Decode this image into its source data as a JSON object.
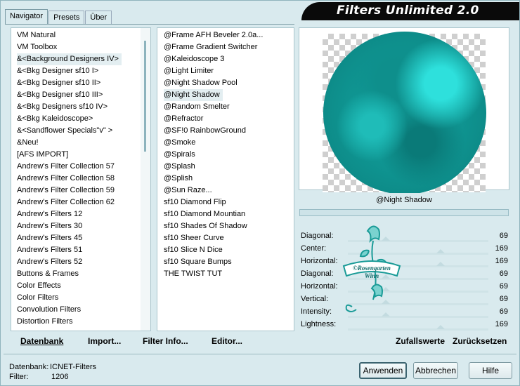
{
  "app": {
    "title": "Filters Unlimited 2.0"
  },
  "tabs": [
    {
      "label": "Navigator",
      "active": true
    },
    {
      "label": "Presets",
      "active": false
    },
    {
      "label": "Über",
      "active": false
    }
  ],
  "categories": [
    "VM Natural",
    "VM Toolbox",
    "&<Background Designers IV>",
    "&<Bkg Designer sf10 I>",
    "&<Bkg Designer sf10 II>",
    "&<Bkg Designer sf10 III>",
    "&<Bkg Designers sf10 IV>",
    "&<Bkg Kaleidoscope>",
    "&<Sandflower Specials\"v\" >",
    "&Neu!",
    "[AFS IMPORT]",
    "Andrew's Filter Collection 57",
    "Andrew's Filter Collection 58",
    "Andrew's Filter Collection 59",
    "Andrew's Filter Collection 62",
    "Andrew's Filters 12",
    "Andrew's Filters 30",
    "Andrew's Filters 45",
    "Andrew's Filters 51",
    "Andrew's Filters 52",
    "Buttons & Frames",
    "Color Effects",
    "Color Filters",
    "Convolution Filters",
    "Distortion Filters"
  ],
  "selected_category_index": 2,
  "filters": [
    "@Frame AFH Beveler 2.0a...",
    "@Frame Gradient Switcher",
    "@Kaleidoscope 3",
    "@Light Limiter",
    "@Night Shadow Pool",
    "@Night Shadow",
    "@Random Smelter",
    "@Refractor",
    "@SF!0 RainbowGround",
    "@Smoke",
    "@Spirals",
    "@Splash",
    "@Splish",
    "@Sun Raze...",
    "sf10 Diamond Flip",
    "sf10 Diamond Mountian",
    "sf10 Shades Of Shadow",
    "sf10 Sheer Curve",
    "sf10 Slice N Dice",
    "sf10 Square Bumps",
    "THE TWIST TUT"
  ],
  "selected_filter_index": 5,
  "preview": {
    "filter_name": "@Night Shadow",
    "color": "#14a8a4"
  },
  "params": [
    {
      "name": "Diagonal:",
      "value": "69",
      "level": 0.27
    },
    {
      "name": "Center:",
      "value": "169",
      "level": 0.66
    },
    {
      "name": "Horizontal:",
      "value": "169",
      "level": 0.66
    },
    {
      "name": "Diagonal:",
      "value": "69",
      "level": 0.27
    },
    {
      "name": "Horizontal:",
      "value": "69",
      "level": 0.27
    },
    {
      "name": "Vertical:",
      "value": "69",
      "level": 0.27
    },
    {
      "name": "Intensity:",
      "value": "69",
      "level": 0.27
    },
    {
      "name": "Lightness:",
      "value": "169",
      "level": 0.66
    }
  ],
  "watermark": {
    "line1": "©Rosengarten",
    "line2": "Winn"
  },
  "left_buttons": [
    {
      "label": "Datenbank",
      "name": "datenbank-button"
    },
    {
      "label": "Import...",
      "name": "import-button"
    },
    {
      "label": "Filter Info...",
      "name": "filter-info-button"
    },
    {
      "label": "Editor...",
      "name": "editor-button"
    }
  ],
  "right_buttons": [
    {
      "label": "Zufallswerte",
      "name": "random-values-button"
    },
    {
      "label": "Zurücksetzen",
      "name": "reset-button"
    }
  ],
  "status": {
    "db_label": "Datenbank:",
    "db_value": "ICNET-Filters",
    "filter_label": "Filter:",
    "filter_value": "1206"
  },
  "dialog_buttons": {
    "apply": "Anwenden",
    "cancel": "Abbrechen",
    "help": "Hilfe"
  }
}
